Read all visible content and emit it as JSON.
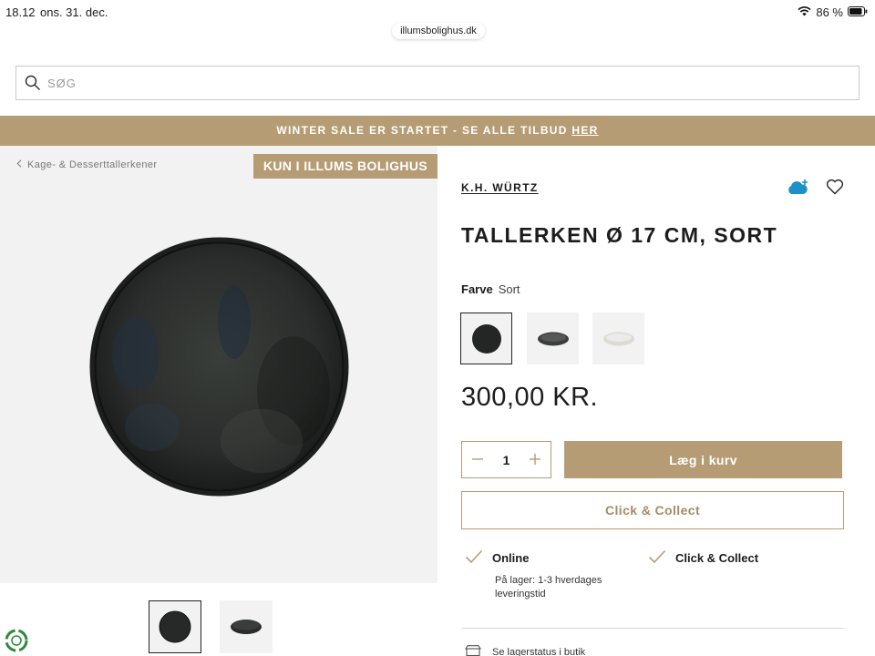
{
  "status_bar": {
    "time": "18.12",
    "date": "ons. 31. dec.",
    "battery": "86 %"
  },
  "browser": {
    "url": "illumsbolighus.dk"
  },
  "search": {
    "placeholder": "SØG"
  },
  "banner": {
    "text": "WINTER SALE ER STARTET - SE ALLE TILBUD ",
    "link": "HER"
  },
  "gallery": {
    "breadcrumb": "Kage- & Desserttallerkener",
    "exclusive_badge": "KUN I ILLUMS BOLIGHUS"
  },
  "product": {
    "brand": "K.H. WÜRTZ",
    "title": "TALLERKEN Ø 17 CM, SORT",
    "color_label": "Farve",
    "color_value": "Sort",
    "price": "300,00 KR.",
    "quantity": "1",
    "add_to_cart": "Læg i kurv",
    "click_collect": "Click & Collect"
  },
  "availability": {
    "online_label": "Online",
    "online_stock": "På lager: 1-3 hverdages leveringstid",
    "cc_label": "Click & Collect",
    "store_status": "Se lagerstatus i butik"
  },
  "colors": {
    "accent": "#b69c74",
    "text": "#1c1c1c",
    "gallery_bg": "#f2f2f2"
  }
}
